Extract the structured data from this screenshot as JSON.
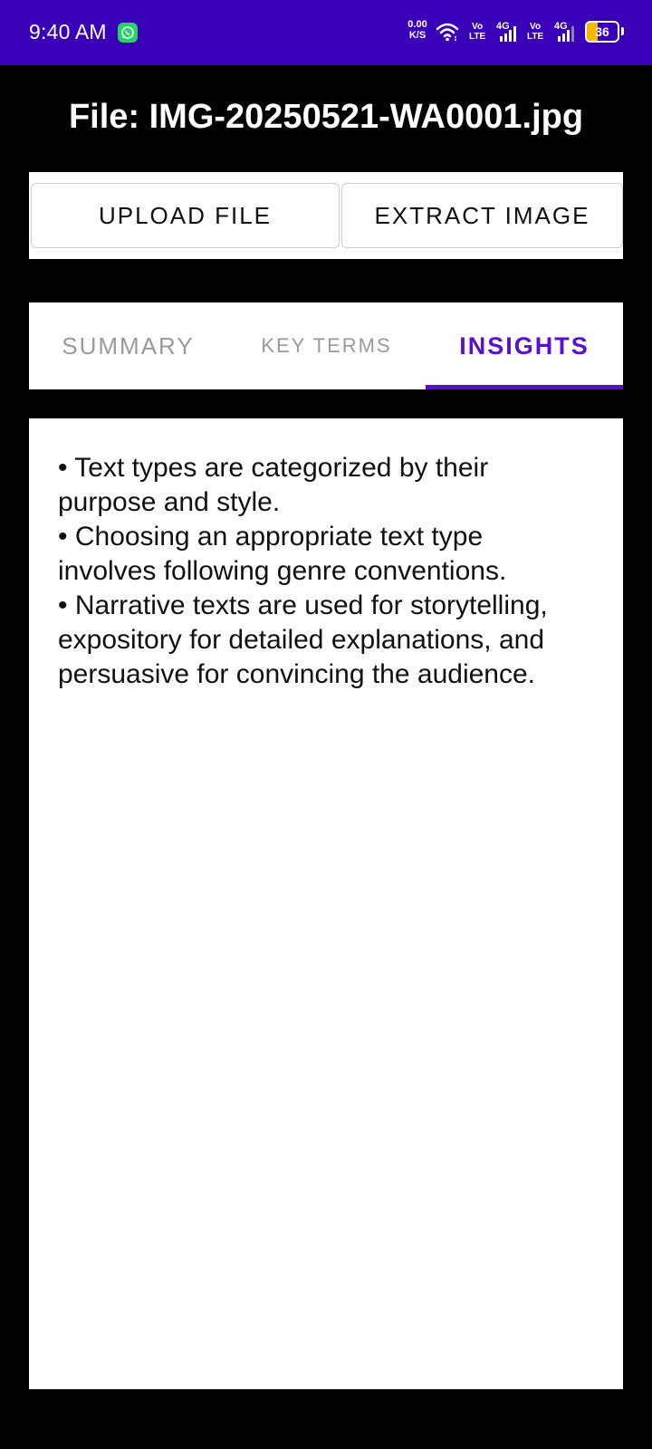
{
  "status_bar": {
    "time": "9:40 AM",
    "net_speed_value": "0.00",
    "net_speed_unit": "K/S",
    "sim1_volte_top": "Vo",
    "sim1_volte_bottom": "LTE",
    "sim1_network": "4G",
    "sim2_volte_top": "Vo",
    "sim2_volte_bottom": "LTE",
    "sim2_network": "4G",
    "battery_level": "36",
    "battery_fraction": 0.36,
    "battery_color": "#f5b800",
    "background_color": "#3a00b8",
    "icons": [
      "whatsapp-icon",
      "wifi-icon",
      "signal-icon",
      "battery-icon"
    ]
  },
  "file_title": "File: IMG-20250521-WA0001.jpg",
  "actions": {
    "upload_label": "UPLOAD FILE",
    "extract_label": "EXTRACT IMAGE"
  },
  "tabs": [
    {
      "label": "SUMMARY",
      "selected": false
    },
    {
      "label": "KEY TERMS",
      "selected": false
    },
    {
      "label": "INSIGHTS",
      "selected": true
    }
  ],
  "accent_color": "#5a0fd0",
  "insights": {
    "lines": [
      "• Text types are categorized by their",
      "purpose and style.",
      "• Choosing an appropriate text type",
      "involves following genre conventions.",
      "• Narrative texts are used for storytelling,",
      "expository for detailed explanations, and",
      "persuasive for convincing the audience."
    ]
  }
}
